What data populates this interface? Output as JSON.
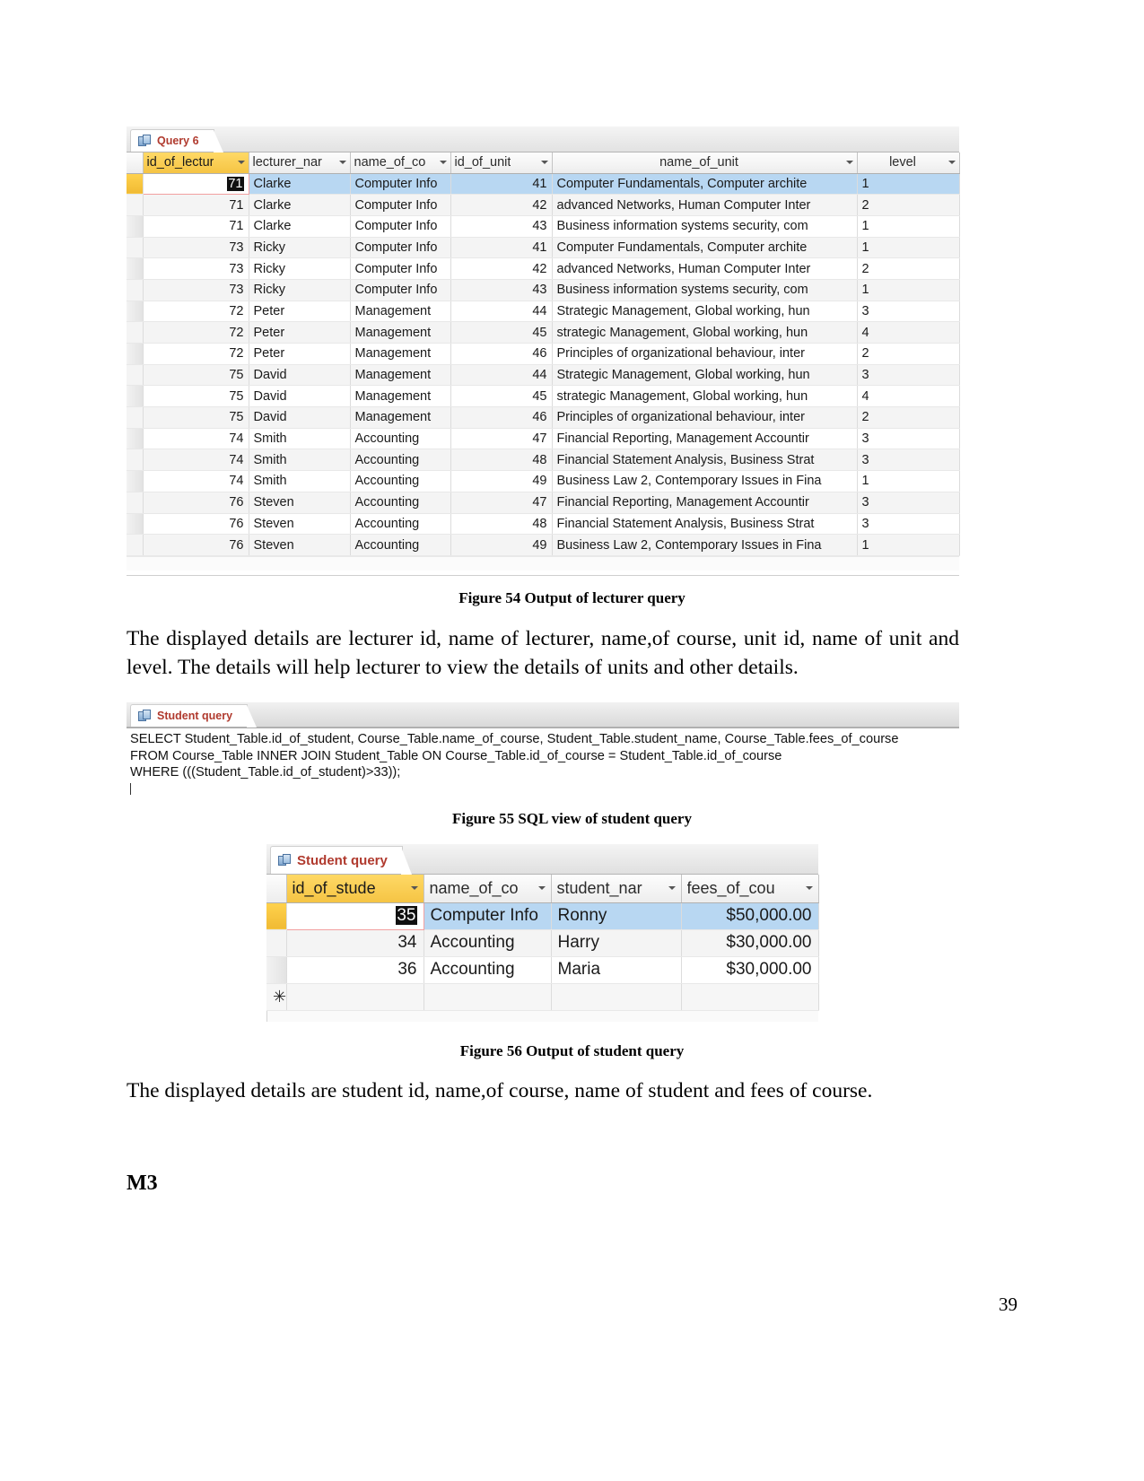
{
  "page": {
    "number": "39",
    "heading_m3": "M3"
  },
  "figure54": {
    "tab_label": "Query 6",
    "tab_icon": "query-datasheet-icon",
    "columns": [
      {
        "name": "id_of_lectur",
        "align": "right",
        "selected": true,
        "has_caret": true
      },
      {
        "name": "lecturer_nar",
        "align": "left",
        "selected": false,
        "has_caret": true
      },
      {
        "name": "name_of_co",
        "align": "left",
        "selected": false,
        "has_caret": true
      },
      {
        "name": "id_of_unit",
        "align": "right",
        "selected": false,
        "has_caret": true
      },
      {
        "name": "name_of_unit",
        "align": "center",
        "selected": false,
        "has_caret": true
      },
      {
        "name": "level",
        "align": "center",
        "selected": false,
        "has_caret": true
      }
    ],
    "rows": [
      {
        "id_of_lecturer": "71",
        "lecturer_name": "Clarke",
        "name_of_course": "Computer Info",
        "id_of_unit": "41",
        "name_of_unit": "Computer Fundamentals, Computer archite",
        "level": "1",
        "selected": true,
        "editing": true
      },
      {
        "id_of_lecturer": "71",
        "lecturer_name": "Clarke",
        "name_of_course": "Computer Info",
        "id_of_unit": "42",
        "name_of_unit": "advanced Networks, Human Computer Inter",
        "level": "2"
      },
      {
        "id_of_lecturer": "71",
        "lecturer_name": "Clarke",
        "name_of_course": "Computer Info",
        "id_of_unit": "43",
        "name_of_unit": "Business information systems security, com",
        "level": "1"
      },
      {
        "id_of_lecturer": "73",
        "lecturer_name": "Ricky",
        "name_of_course": "Computer Info",
        "id_of_unit": "41",
        "name_of_unit": "Computer Fundamentals, Computer archite",
        "level": "1"
      },
      {
        "id_of_lecturer": "73",
        "lecturer_name": "Ricky",
        "name_of_course": "Computer Info",
        "id_of_unit": "42",
        "name_of_unit": "advanced Networks, Human Computer Inter",
        "level": "2"
      },
      {
        "id_of_lecturer": "73",
        "lecturer_name": "Ricky",
        "name_of_course": "Computer Info",
        "id_of_unit": "43",
        "name_of_unit": "Business information systems security, com",
        "level": "1"
      },
      {
        "id_of_lecturer": "72",
        "lecturer_name": "Peter",
        "name_of_course": "Management",
        "id_of_unit": "44",
        "name_of_unit": "Strategic Management, Global working, hun",
        "level": "3"
      },
      {
        "id_of_lecturer": "72",
        "lecturer_name": "Peter",
        "name_of_course": "Management",
        "id_of_unit": "45",
        "name_of_unit": "strategic Management, Global working, hun",
        "level": "4"
      },
      {
        "id_of_lecturer": "72",
        "lecturer_name": "Peter",
        "name_of_course": "Management",
        "id_of_unit": "46",
        "name_of_unit": "Principles of organizational behaviour, inter",
        "level": "2"
      },
      {
        "id_of_lecturer": "75",
        "lecturer_name": "David",
        "name_of_course": "Management",
        "id_of_unit": "44",
        "name_of_unit": "Strategic Management, Global working, hun",
        "level": "3"
      },
      {
        "id_of_lecturer": "75",
        "lecturer_name": "David",
        "name_of_course": "Management",
        "id_of_unit": "45",
        "name_of_unit": "strategic Management, Global working, hun",
        "level": "4"
      },
      {
        "id_of_lecturer": "75",
        "lecturer_name": "David",
        "name_of_course": "Management",
        "id_of_unit": "46",
        "name_of_unit": "Principles of organizational behaviour, inter",
        "level": "2"
      },
      {
        "id_of_lecturer": "74",
        "lecturer_name": "Smith",
        "name_of_course": "Accounting",
        "id_of_unit": "47",
        "name_of_unit": "Financial Reporting, Management Accountir",
        "level": "3"
      },
      {
        "id_of_lecturer": "74",
        "lecturer_name": "Smith",
        "name_of_course": "Accounting",
        "id_of_unit": "48",
        "name_of_unit": "Financial Statement Analysis, Business Strat",
        "level": "3"
      },
      {
        "id_of_lecturer": "74",
        "lecturer_name": "Smith",
        "name_of_course": "Accounting",
        "id_of_unit": "49",
        "name_of_unit": "Business Law 2, Contemporary Issues in Fina",
        "level": "1"
      },
      {
        "id_of_lecturer": "76",
        "lecturer_name": "Steven",
        "name_of_course": "Accounting",
        "id_of_unit": "47",
        "name_of_unit": "Financial Reporting, Management Accountir",
        "level": "3"
      },
      {
        "id_of_lecturer": "76",
        "lecturer_name": "Steven",
        "name_of_course": "Accounting",
        "id_of_unit": "48",
        "name_of_unit": "Financial Statement Analysis, Business Strat",
        "level": "3"
      },
      {
        "id_of_lecturer": "76",
        "lecturer_name": "Steven",
        "name_of_course": "Accounting",
        "id_of_unit": "49",
        "name_of_unit": "Business Law 2, Contemporary Issues in Fina",
        "level": "1"
      }
    ],
    "caption": "Figure 54 Output of lecturer query"
  },
  "paragraph1": "The displayed details are lecturer id, name of lecturer, name,of course, unit id, name of unit and level. The details will help lecturer to view the details of units and other details.",
  "figure55": {
    "tab_label": "Student query",
    "tab_icon": "query-sql-icon",
    "sql_lines": [
      "SELECT Student_Table.id_of_student, Course_Table.name_of_course, Student_Table.student_name, Course_Table.fees_of_course",
      "FROM Course_Table INNER JOIN Student_Table ON Course_Table.id_of_course = Student_Table.id_of_course",
      "WHERE (((Student_Table.id_of_student)>33));"
    ],
    "caption": "Figure 55 SQL view of student query"
  },
  "figure56": {
    "tab_label": "Student query",
    "tab_icon": "query-datasheet-icon",
    "columns": [
      {
        "name": "id_of_stude",
        "align": "right",
        "selected": true,
        "has_caret": true
      },
      {
        "name": "name_of_co",
        "align": "left",
        "selected": false,
        "has_caret": true
      },
      {
        "name": "student_nar",
        "align": "left",
        "selected": false,
        "has_caret": true
      },
      {
        "name": "fees_of_cou",
        "align": "left",
        "selected": false,
        "has_caret": true
      }
    ],
    "rows": [
      {
        "id_of_student": "35",
        "name_of_course": "Computer Info",
        "student_name": "Ronny",
        "fees_of_course": "$50,000.00",
        "selected": true,
        "editing": true
      },
      {
        "id_of_student": "34",
        "name_of_course": "Accounting",
        "student_name": "Harry",
        "fees_of_course": "$30,000.00"
      },
      {
        "id_of_student": "36",
        "name_of_course": "Accounting",
        "student_name": "Maria",
        "fees_of_course": "$30,000.00"
      }
    ],
    "new_record_marker": "✳",
    "caption": "Figure 56 Output of student query"
  },
  "paragraph2": "The displayed details are student id, name,of course, name of student and fees of course.",
  "colors": {
    "tab_text": "#b03a2e",
    "selected_row": "#b8d7f2",
    "selected_column_header": "#ffd24d",
    "edit_border": "#f2a0a0"
  }
}
